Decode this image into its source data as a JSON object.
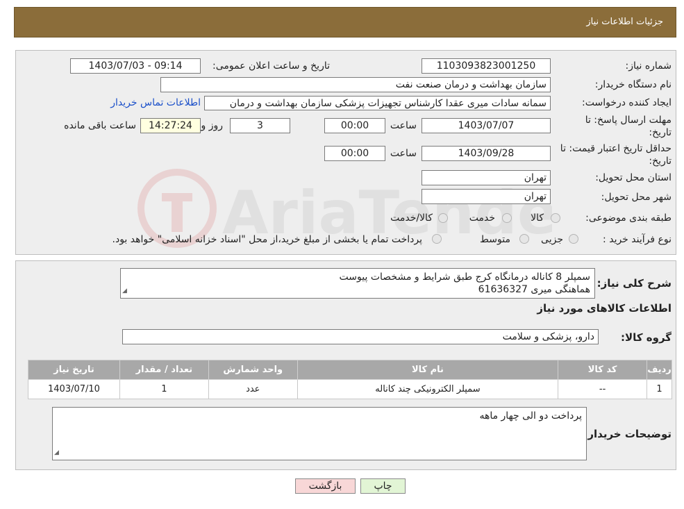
{
  "header": {
    "title": "جزئیات اطلاعات نیاز"
  },
  "form": {
    "need_number_label": "شماره نیاز:",
    "need_number": "1103093823001250",
    "announce_label": "تاریخ و ساعت اعلان عمومی:",
    "announce_value": "1403/07/03 - 09:14",
    "buyer_org_label": "نام دستگاه خریدار:",
    "buyer_org": "سازمان بهداشت و درمان صنعت نفت",
    "creator_label": "ایجاد کننده درخواست:",
    "creator": "سمانه سادات میری عقدا کارشناس تجهیزات پزشکی سازمان بهداشت و درمان",
    "contact_link": "اطلاعات تماس خریدار",
    "deadline_label_1": "مهلت ارسال پاسخ: تا",
    "deadline_label_2": "تاریخ:",
    "deadline_date": "1403/07/07",
    "time_label": "ساعت",
    "deadline_time": "00:00",
    "days_value": "3",
    "days_label": "روز و",
    "remaining_time": "14:27:24",
    "remaining_label": "ساعت باقی مانده",
    "validity_label_1": "حداقل تاریخ اعتبار قیمت: تا",
    "validity_label_2": "تاریخ:",
    "validity_date": "1403/09/28",
    "validity_time": "00:00",
    "province_label": "استان محل تحویل:",
    "province": "تهران",
    "city_label": "شهر محل تحویل:",
    "city": "تهران",
    "category_label": "طبقه بندی موضوعی:",
    "category_options": [
      "کالا",
      "خدمت",
      "کالا/خدمت"
    ],
    "process_label": "نوع فرآیند خرید :",
    "process_options": [
      "جزیی",
      "متوسط"
    ],
    "process_note": "پرداخت تمام یا بخشی از مبلغ خرید،از محل \"اسناد خزانه اسلامی\" خواهد بود."
  },
  "details": {
    "summary_label": "شرح کلی نیاز:",
    "summary_line1": "سمپلر 8 کاناله درمانگاه کرج طبق شرایط و مشخصات پیوست",
    "summary_line2": "هماهنگی میری 61636327",
    "goods_info_title": "اطلاعات کالاهای مورد نیاز",
    "goods_group_label": "گروه کالا:",
    "goods_group": "دارو، پزشکی و سلامت",
    "buyer_notes_label": "توضیحات خریدار:",
    "buyer_notes": "پرداخت دو الی چهار ماهه"
  },
  "table": {
    "headers": [
      "ردیف",
      "کد کالا",
      "نام کالا",
      "واحد شمارش",
      "تعداد / مقدار",
      "تاریخ نیاز"
    ],
    "rows": [
      [
        "1",
        "--",
        "سمپلر الکترونیکی چند کاناله",
        "عدد",
        "1",
        "1403/07/10"
      ]
    ]
  },
  "buttons": {
    "print": "چاپ",
    "back": "بازگشت"
  },
  "watermark": {
    "text": "AriaTender.neT"
  },
  "colors": {
    "header": "#8b6d3a",
    "link": "#1a4fc9",
    "back_button": "#f8d7d7",
    "print_button": "#e2f5d5"
  }
}
